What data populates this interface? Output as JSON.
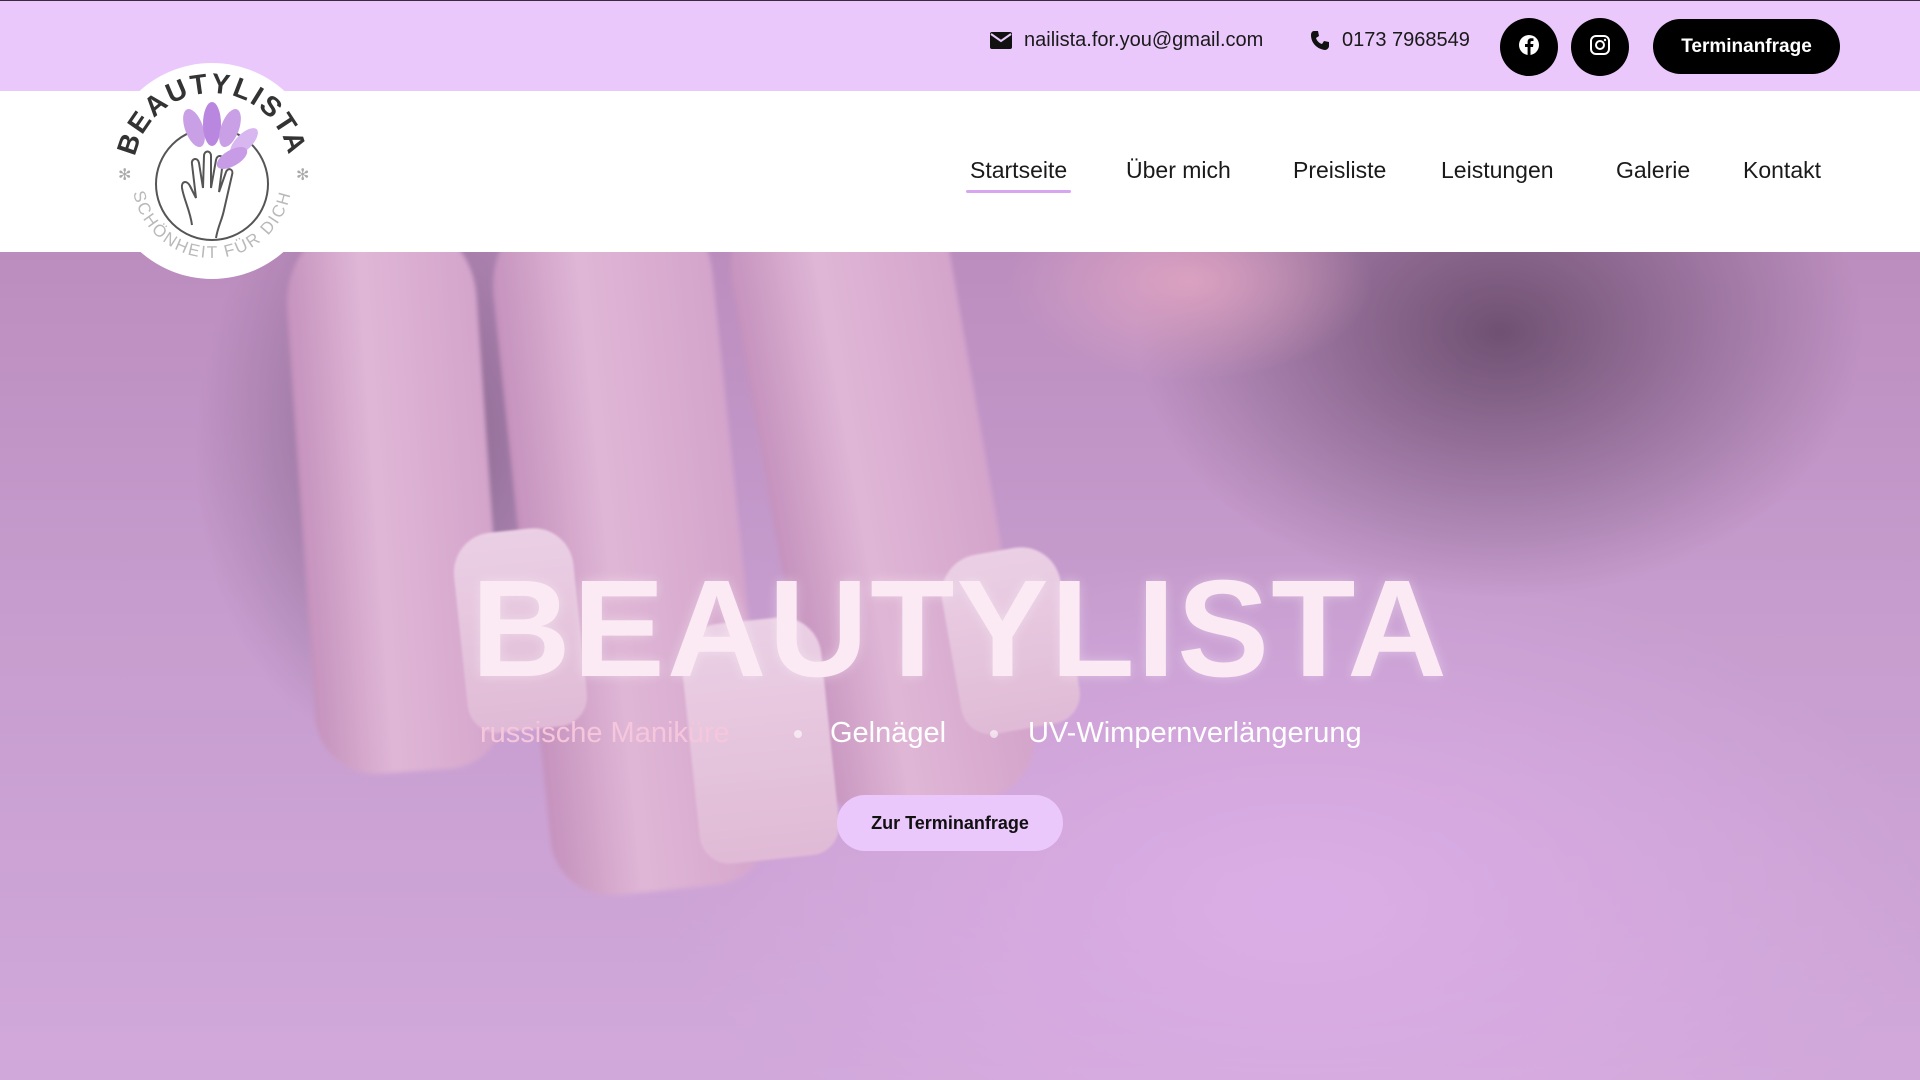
{
  "topbar": {
    "email": "nailista.for.you@gmail.com",
    "phone": "0173 7968549",
    "cta_label": "Terminanfrage",
    "icons": [
      "envelope-icon",
      "phone-icon",
      "facebook-icon",
      "instagram-icon"
    ]
  },
  "logo": {
    "brand": "BEAUTYLISTA",
    "tagline": "SCHÖNHEIT FÜR DICH"
  },
  "nav": {
    "items": [
      {
        "label": "Startseite",
        "active": true
      },
      {
        "label": "Über mich",
        "active": false
      },
      {
        "label": "Preisliste",
        "active": false
      },
      {
        "label": "Leistungen",
        "active": false
      },
      {
        "label": "Galerie",
        "active": false
      },
      {
        "label": "Kontakt",
        "active": false
      }
    ]
  },
  "hero": {
    "title": "BEAUTYLISTA",
    "services": [
      "russische Maniküre",
      "Gelnägel",
      "UV-Wimpernverlängerung"
    ],
    "cta_label": "Zur Terminanfrage"
  },
  "colors": {
    "accent_lilac": "#ebc8fb",
    "black": "#000000",
    "pink": "#f2a5be"
  }
}
